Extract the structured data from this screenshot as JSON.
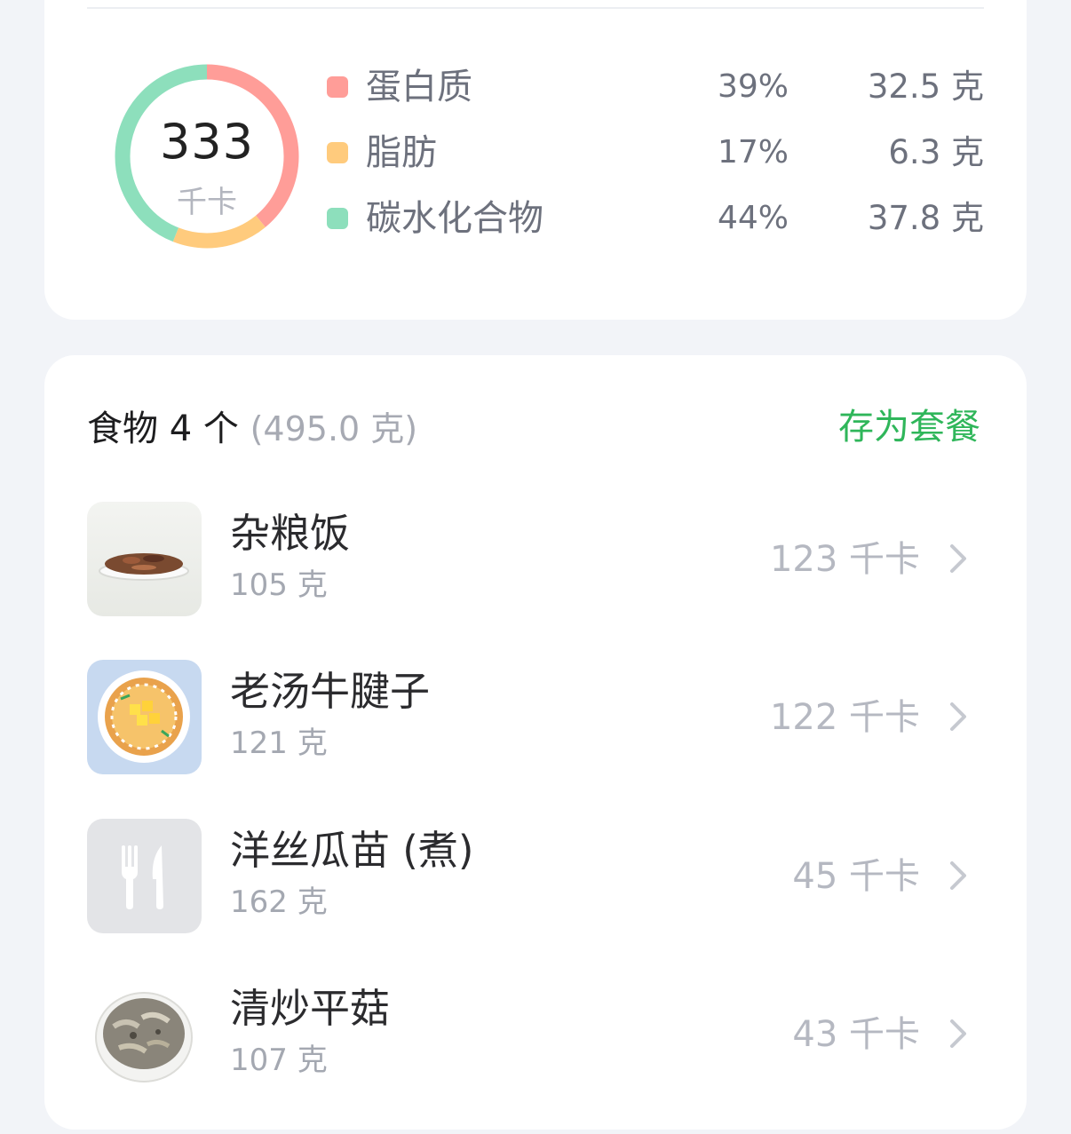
{
  "summary": {
    "kcal_value": "333",
    "kcal_unit": "千卡",
    "macros": [
      {
        "name": "蛋白质",
        "percent": "39%",
        "grams": "32.5 克",
        "color": "#ff9d98",
        "share": 0.39
      },
      {
        "name": "脂肪",
        "percent": "17%",
        "grams": "6.3 克",
        "color": "#ffcb7d",
        "share": 0.17
      },
      {
        "name": "碳水化合物",
        "percent": "44%",
        "grams": "37.8 克",
        "color": "#8ddfbc",
        "share": 0.44
      }
    ]
  },
  "foods": {
    "title": "食物 4 个",
    "total_weight": "(495.0 克)",
    "save_label": "存为套餐",
    "accent_color": "#2fb65a",
    "items": [
      {
        "name": "杂粮饭",
        "weight": "105 克",
        "kcal": "123 千卡",
        "icon": "mixed-grain-rice-photo"
      },
      {
        "name": "老汤牛腱子",
        "weight": "121 克",
        "kcal": "122 千卡",
        "icon": "braised-beef-shank-illustration"
      },
      {
        "name": "洋丝瓜苗 (煮)",
        "weight": "162 克",
        "kcal": "45 千卡",
        "icon": "fork-knife-icon"
      },
      {
        "name": "清炒平菇",
        "weight": "107 克",
        "kcal": "43 千卡",
        "icon": "oyster-mushroom-photo"
      }
    ]
  }
}
